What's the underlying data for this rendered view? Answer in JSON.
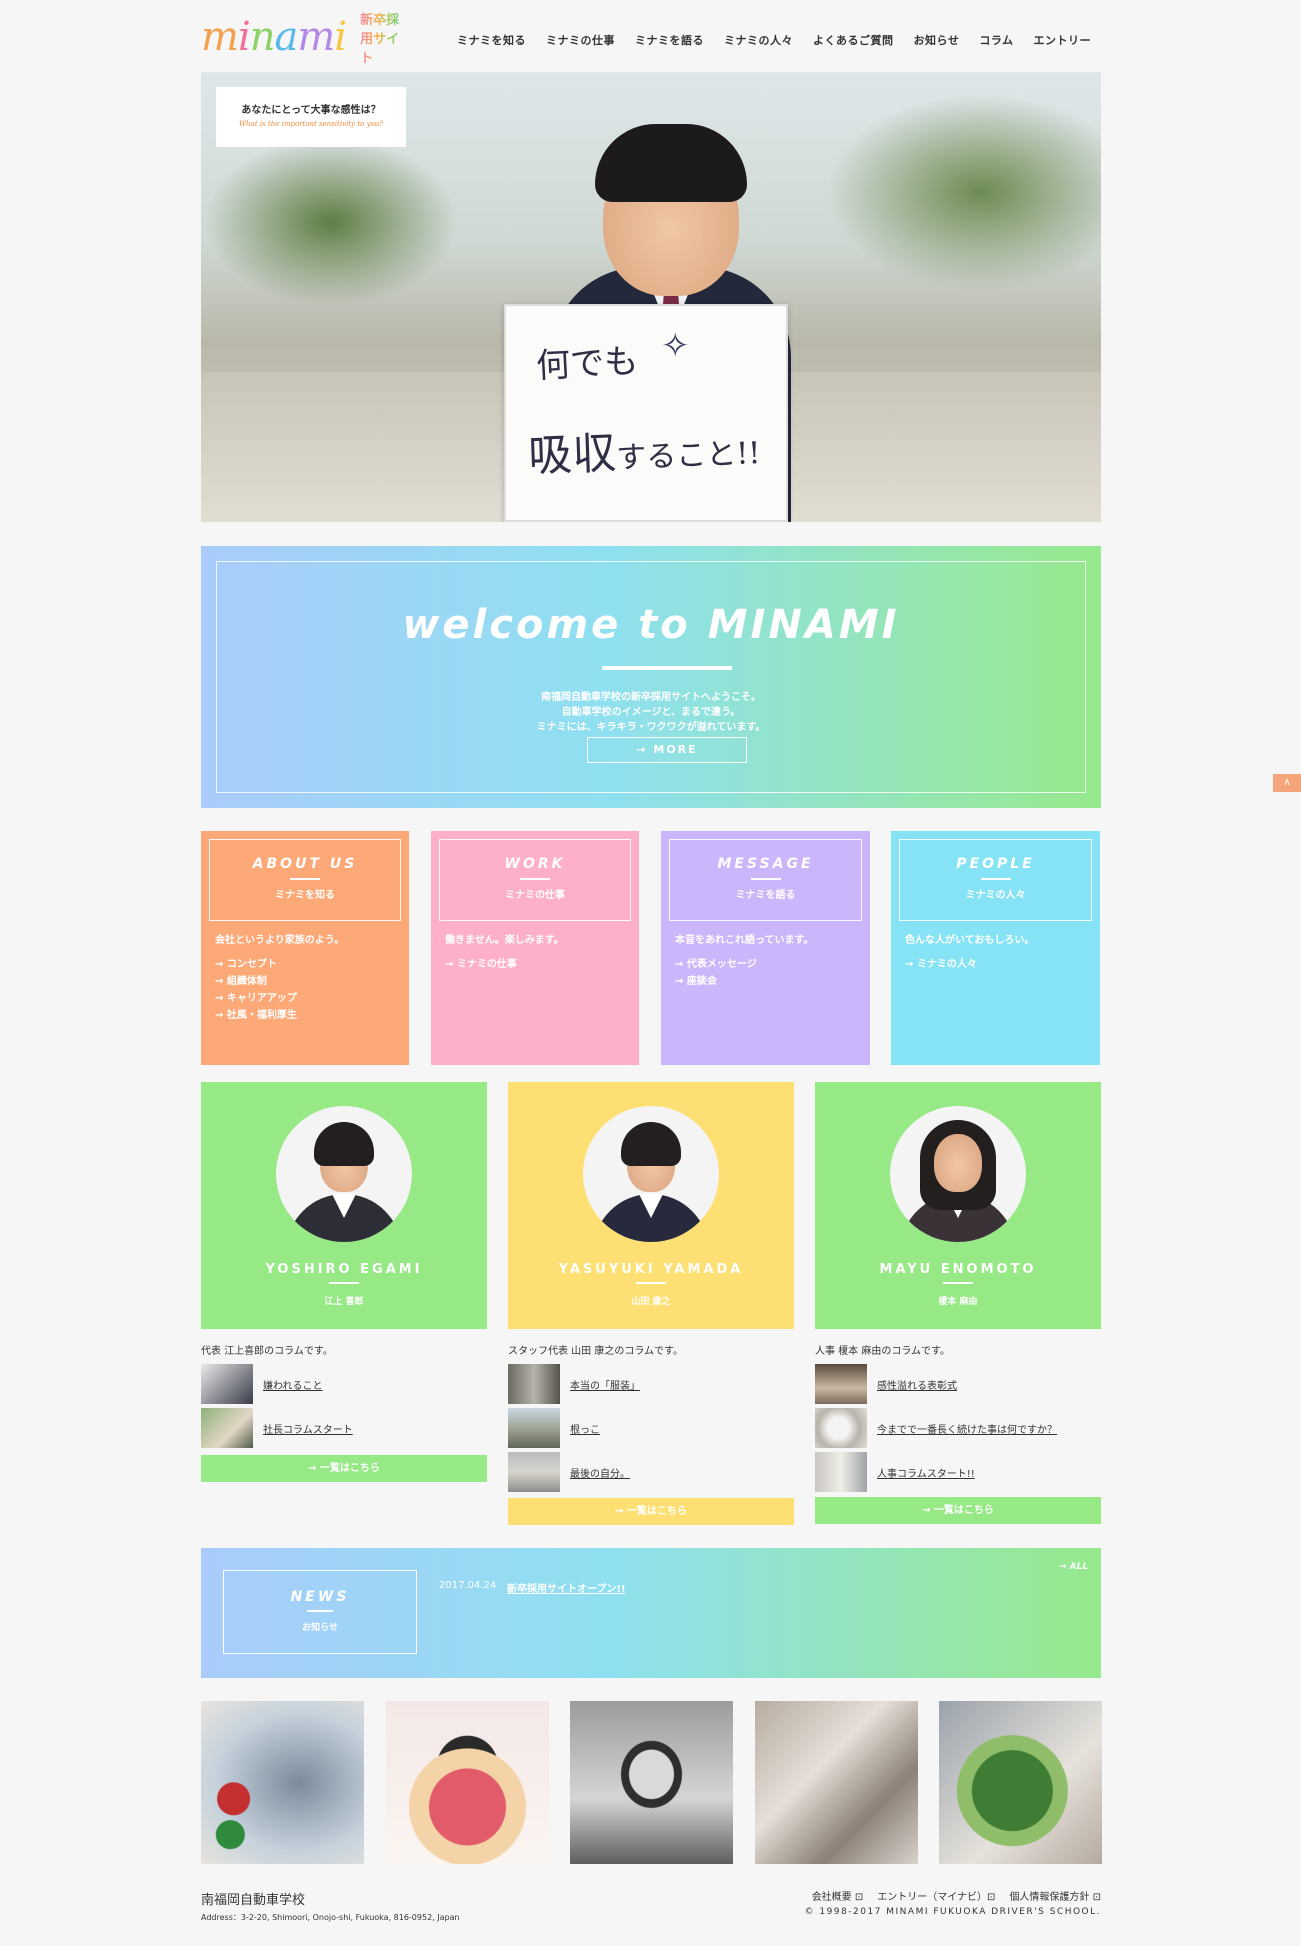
{
  "header": {
    "logo_text": "minami",
    "logo_sub": "新卒採用サイト",
    "nav": [
      "ミナミを知る",
      "ミナミの仕事",
      "ミナミを語る",
      "ミナミの人々",
      "よくあるご質問",
      "お知らせ",
      "コラム",
      "エントリー"
    ]
  },
  "hero": {
    "question": "あなたにとって大事な感性は？",
    "question_en": "What is the important sensitivity to you?",
    "board_line1": "何でも",
    "board_line2": "吸収",
    "board_line2_small": "すること!!",
    "board_spark": "✧"
  },
  "welcome": {
    "title": "welcome to MINAMI",
    "text1": "南福岡自動車学校の新卒採用サイトへようこそ。",
    "text2": "自動車学校のイメージと、まるで違う。",
    "text3": "ミナミには、キラキラ・ワクワクが溢れています。",
    "more": "→ MORE"
  },
  "categories": [
    {
      "title": "ABOUT US",
      "sub": "ミナミを知る",
      "lead": "会社というより家族のよう。",
      "links": [
        "→ コンセプト",
        "→ 組織体制",
        "→ キャリアアップ",
        "→ 社風・福利厚生"
      ],
      "color": "#fda877"
    },
    {
      "title": "WORK",
      "sub": "ミナミの仕事",
      "lead": "働きません。楽しみます。",
      "links": [
        "→ ミナミの仕事"
      ],
      "color": "#feb0c8"
    },
    {
      "title": "MESSAGE",
      "sub": "ミナミを語る",
      "lead": "本音をあれこれ語っています。",
      "links": [
        "→ 代表メッセージ",
        "→ 座談会"
      ],
      "color": "#cbb5fb"
    },
    {
      "title": "PEOPLE",
      "sub": "ミナミの人々",
      "lead": "色んな人がいておもしろい。",
      "links": [
        "→ ミナミの人々"
      ],
      "color": "#86e3f5"
    }
  ],
  "columnists": [
    {
      "name": "YOSHIRO EGAMI",
      "name_jp": "江上 喜郎",
      "color": "#97e986",
      "lead": "代表 江上喜郎のコラムです。",
      "posts": [
        "嫌われること",
        "社長コラムスタート"
      ],
      "button": "→ 一覧はこちら"
    },
    {
      "name": "YASUYUKI YAMADA",
      "name_jp": "山田 康之",
      "color": "#fedf73",
      "lead": "スタッフ代表 山田 康之のコラムです。",
      "posts": [
        "本当の「服装」",
        "根っこ",
        "最後の自分。"
      ],
      "button": "→ 一覧はこちら"
    },
    {
      "name": "MAYU ENOMOTO",
      "name_jp": "榎本 麻由",
      "color": "#97e986",
      "lead": "人事 榎本 麻由のコラムです。",
      "posts": [
        "感性溢れる表彰式",
        "今までで一番長く続けた事は何ですか？",
        "人事コラムスタート!!"
      ],
      "button": "→ 一覧はこちら"
    }
  ],
  "news": {
    "title": "NEWS",
    "sub": "お知らせ",
    "date": "2017.04.24",
    "item": "新卒採用サイトオープン!!",
    "all": "→ ALL"
  },
  "footer": {
    "name": "南福岡自動車学校",
    "address": "Address：3-2-20, Shimoori, Onojo-shi, Fukuoka, 816-0952, Japan",
    "links": [
      "会社概要 ⊡",
      "エントリー（マイナビ）⊡",
      "個人情報保護方針 ⊡"
    ],
    "copyright": "© 1998-2017 MINAMI FUKUOKA DRIVER'S SCHOOL."
  },
  "totop": "∧"
}
